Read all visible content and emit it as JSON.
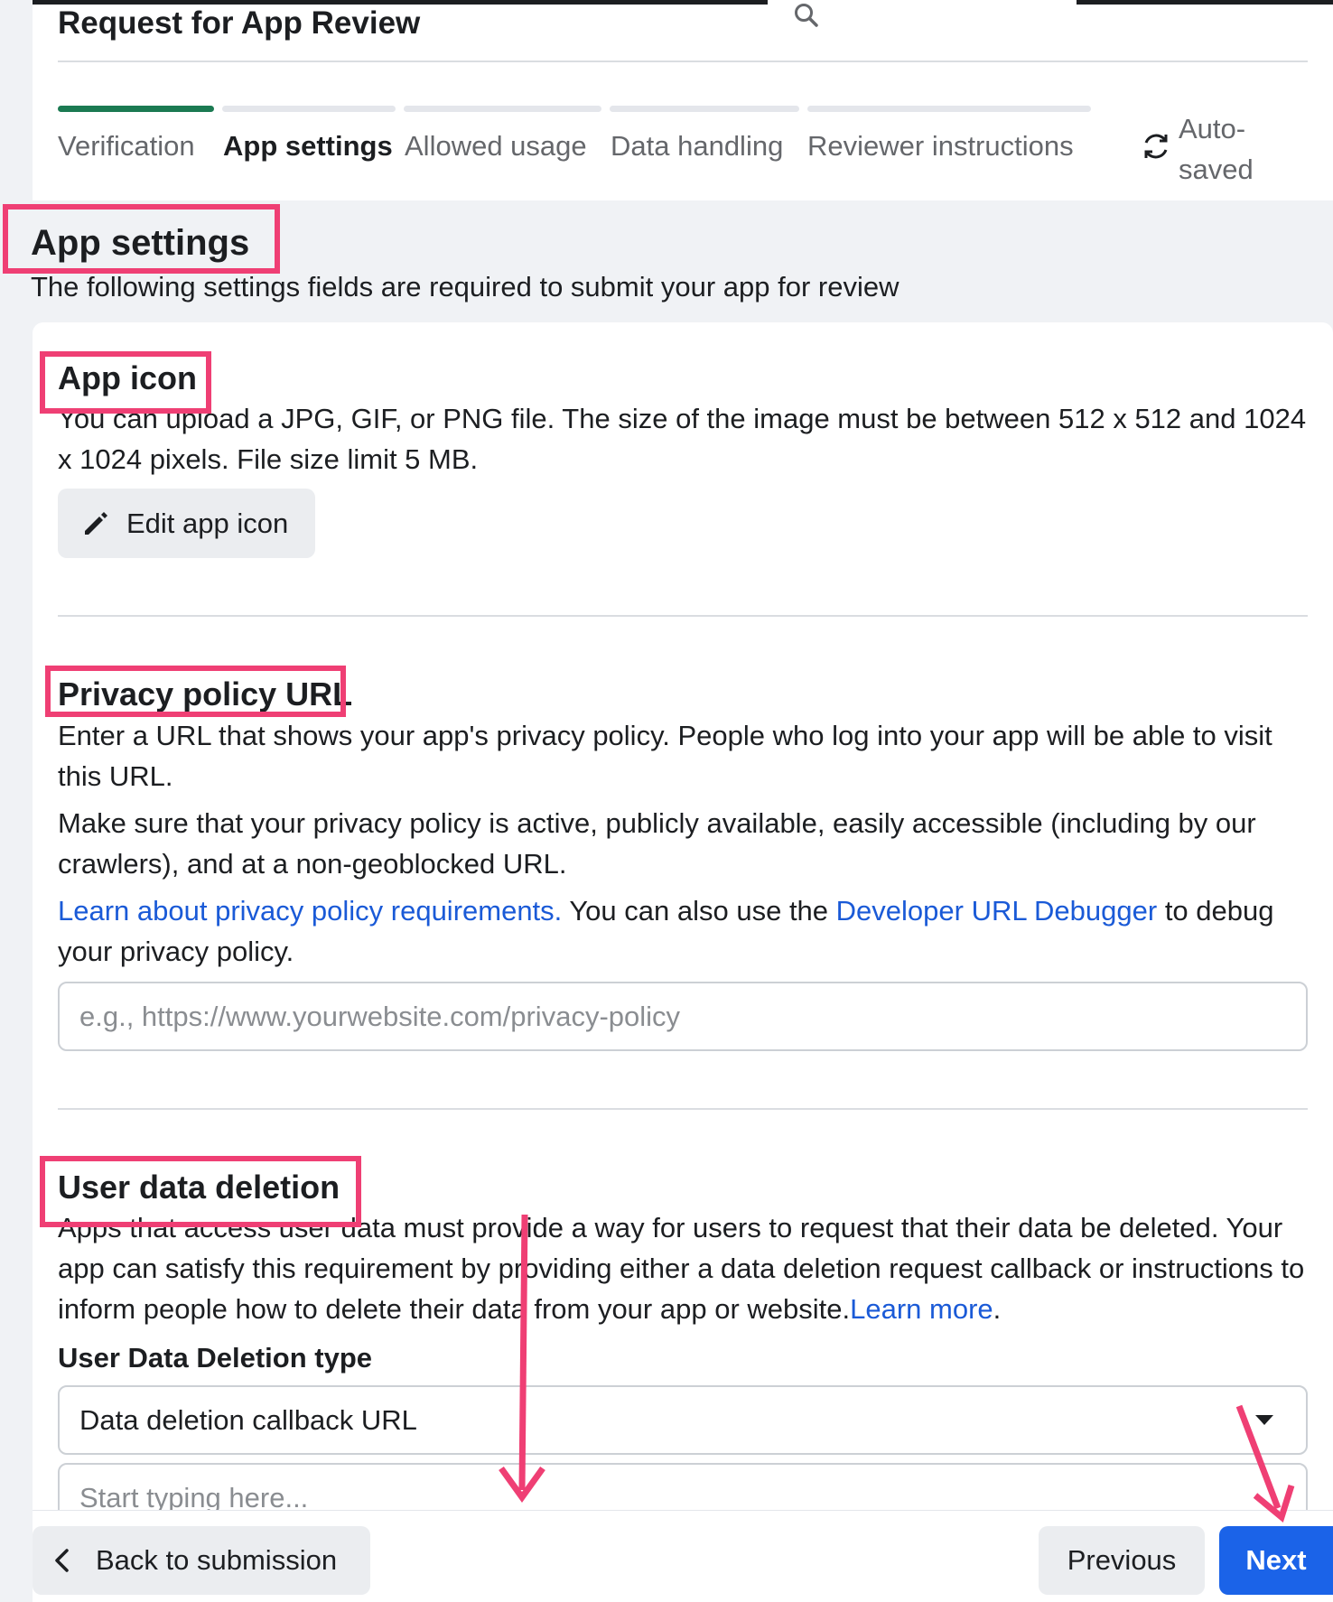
{
  "header": {
    "title": "Request for App Review"
  },
  "stepper": {
    "steps": [
      {
        "label": "Verification",
        "state": "complete"
      },
      {
        "label": "App settings",
        "state": "active"
      },
      {
        "label": "Allowed usage",
        "state": "upcoming"
      },
      {
        "label": "Data handling",
        "state": "upcoming"
      },
      {
        "label": "Reviewer instructions",
        "state": "upcoming"
      }
    ],
    "autosave_label": "Auto-saved"
  },
  "section": {
    "title": "App settings",
    "subtitle": "The following settings fields are required to submit your app for review"
  },
  "app_icon": {
    "title": "App icon",
    "description": "You can upload a JPG, GIF, or PNG file. The size of the image must be between 512 x 512 and 1024 x 1024 pixels. File size limit 5 MB.",
    "edit_button_label": "Edit app icon"
  },
  "privacy_policy": {
    "title": "Privacy policy URL",
    "description": "Enter a URL that shows your app's privacy policy. People who log into your app will be able to visit this URL.",
    "requirements": "Make sure that your privacy policy is active, publicly available, easily accessible (including by our crawlers), and at a non-geoblocked URL.",
    "link_learn": "Learn about privacy policy requirements.",
    "text_mid": " You can also use the ",
    "link_debugger": "Developer URL Debugger",
    "text_end": " to debug your privacy policy.",
    "input_placeholder": "e.g., https://www.yourwebsite.com/privacy-policy",
    "input_value": ""
  },
  "user_data_deletion": {
    "title": "User data deletion",
    "description": "Apps that access user data must provide a way for users to request that their data be deleted. Your app can satisfy this requirement by providing either a data deletion request callback or instructions to inform people how to delete their data from your app or website.",
    "link_learn_more": "Learn more",
    "description_end": ".",
    "type_label": "User Data Deletion type",
    "type_selected": "Data deletion callback URL",
    "callback_placeholder": "Start typing here...",
    "callback_value": ""
  },
  "footer": {
    "back_label": "Back to submission",
    "previous_label": "Previous",
    "next_label": "Next"
  },
  "colors": {
    "accent_blue": "#1b63e8",
    "link_blue": "#1a5ad7",
    "progress_green": "#1b7a52",
    "annotation_pink": "#ef3f74"
  },
  "icons": {
    "search": "search-icon",
    "autosave": "sync-icon",
    "edit": "pencil-icon",
    "back": "chevron-left-icon",
    "dropdown": "caret-down-icon"
  }
}
